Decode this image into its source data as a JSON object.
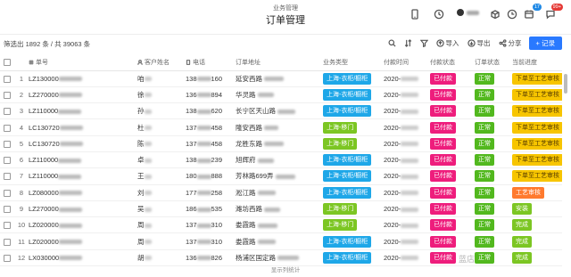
{
  "header": {
    "subtitle": "业务管理",
    "title": "订单管理",
    "badge_1": "17",
    "badge_2": "99+"
  },
  "toolbar": {
    "count_text": "筛选出 1892 条 / 共 39063 条",
    "import_label": "导入",
    "export_label": "导出",
    "share_label": "分享",
    "add_label": "+ 记录"
  },
  "columns": [
    "单号",
    "客户姓名",
    "电话",
    "订单地址",
    "业务类型",
    "付款时间",
    "付款状态",
    "订单状态",
    "当前进度"
  ],
  "rows": [
    {
      "idx": "1",
      "no": "LZ130000",
      "name": "咱",
      "phone_a": "138",
      "phone_b": "160",
      "addr": "延安西路",
      "biz": "上海-衣柜/橱柜",
      "biz_color": "#1ea7e8",
      "time": "2020-",
      "pay": "已付款",
      "status": "正常",
      "progress": "下单至工艺审核",
      "progress_color": "#f7c500"
    },
    {
      "idx": "2",
      "no": "LZ270000",
      "name": "徐",
      "phone_a": "136",
      "phone_b": "894",
      "addr": "华灵路",
      "biz": "上海-衣柜/橱柜",
      "biz_color": "#1ea7e8",
      "time": "2020-",
      "pay": "已付款",
      "status": "正常",
      "progress": "下单至工艺审核",
      "progress_color": "#f7c500"
    },
    {
      "idx": "3",
      "no": "LZ110000",
      "name": "孙",
      "phone_a": "138",
      "phone_b": "620",
      "addr": "长宁区天山路",
      "biz": "上海-衣柜/橱柜",
      "biz_color": "#1ea7e8",
      "time": "2020-",
      "pay": "已付款",
      "status": "正常",
      "progress": "下单至工艺审核",
      "progress_color": "#f7c500"
    },
    {
      "idx": "4",
      "no": "LC130720",
      "name": "杜",
      "phone_a": "137",
      "phone_b": "458",
      "addr": "隆安西路",
      "biz": "上海-移门",
      "biz_color": "#7cc623",
      "time": "2020-",
      "pay": "已付款",
      "status": "正常",
      "progress": "下单至工艺审核",
      "progress_color": "#f7c500"
    },
    {
      "idx": "5",
      "no": "LC130720",
      "name": "陈",
      "phone_a": "137",
      "phone_b": "458",
      "addr": "龙胜东路",
      "biz": "上海-移门",
      "biz_color": "#7cc623",
      "time": "2020-",
      "pay": "已付款",
      "status": "正常",
      "progress": "下单至工艺审核",
      "progress_color": "#f7c500"
    },
    {
      "idx": "6",
      "no": "LZ110000",
      "name": "卓",
      "phone_a": "138",
      "phone_b": "239",
      "addr": "旭辉府",
      "biz": "上海-衣柜/橱柜",
      "biz_color": "#1ea7e8",
      "time": "2020-",
      "pay": "已付款",
      "status": "正常",
      "progress": "下单至工艺审核",
      "progress_color": "#f7c500"
    },
    {
      "idx": "7",
      "no": "LZ110000",
      "name": "王",
      "phone_a": "180",
      "phone_b": "888",
      "addr": "芳林路699弄",
      "biz": "上海-衣柜/橱柜",
      "biz_color": "#1ea7e8",
      "time": "2020-",
      "pay": "已付款",
      "status": "正常",
      "progress": "下单至工艺审核",
      "progress_color": "#f7c500"
    },
    {
      "idx": "8",
      "no": "LZ080000",
      "name": "刘",
      "phone_a": "177",
      "phone_b": "258",
      "addr": "淞江路",
      "biz": "上海-衣柜/橱柜",
      "biz_color": "#1ea7e8",
      "time": "2020-",
      "pay": "已付款",
      "status": "正常",
      "progress": "工艺审核",
      "progress_color": "#ff7a2e"
    },
    {
      "idx": "9",
      "no": "LZ270000",
      "name": "吴",
      "phone_a": "186",
      "phone_b": "535",
      "addr": "潍坊西路",
      "biz": "上海-移门",
      "biz_color": "#7cc623",
      "time": "2020-",
      "pay": "已付款",
      "status": "正常",
      "progress": "安装",
      "progress_color": "#7cc623"
    },
    {
      "idx": "10",
      "no": "LZ020000",
      "name": "周",
      "phone_a": "137",
      "phone_b": "310",
      "addr": "娄霞路",
      "biz": "上海-移门",
      "biz_color": "#7cc623",
      "time": "2020-",
      "pay": "已付款",
      "status": "正常",
      "progress": "完成",
      "progress_color": "#7cc623"
    },
    {
      "idx": "11",
      "no": "LZ020000",
      "name": "周",
      "phone_a": "137",
      "phone_b": "310",
      "addr": "娄霞路",
      "biz": "上海-衣柜/橱柜",
      "biz_color": "#1ea7e8",
      "time": "2020-",
      "pay": "已付款",
      "status": "正常",
      "progress": "完成",
      "progress_color": "#7cc623"
    },
    {
      "idx": "12",
      "no": "LX030000",
      "name": "胡",
      "phone_a": "136",
      "phone_b": "826",
      "addr": "杨浦区国定路",
      "biz": "上海-衣柜/橱柜",
      "biz_color": "#1ea7e8",
      "time": "2020-",
      "pay": "已付款",
      "status": "正常",
      "progress": "完成",
      "progress_color": "#7cc623"
    }
  ],
  "colors": {
    "pay_status": "#ee1d7c",
    "order_status": "#52b81e",
    "accent": "#2979ff"
  },
  "footer": "显示列统计",
  "watermark": "蓝店"
}
